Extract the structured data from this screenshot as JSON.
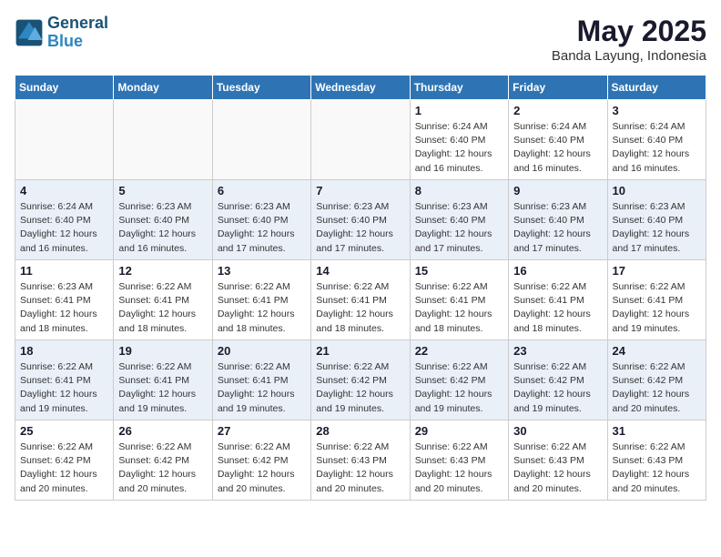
{
  "logo": {
    "line1": "General",
    "line2": "Blue"
  },
  "title": "May 2025",
  "location": "Banda Layung, Indonesia",
  "days_of_week": [
    "Sunday",
    "Monday",
    "Tuesday",
    "Wednesday",
    "Thursday",
    "Friday",
    "Saturday"
  ],
  "weeks": [
    [
      {
        "day": "",
        "info": ""
      },
      {
        "day": "",
        "info": ""
      },
      {
        "day": "",
        "info": ""
      },
      {
        "day": "",
        "info": ""
      },
      {
        "day": "1",
        "info": "Sunrise: 6:24 AM\nSunset: 6:40 PM\nDaylight: 12 hours\nand 16 minutes."
      },
      {
        "day": "2",
        "info": "Sunrise: 6:24 AM\nSunset: 6:40 PM\nDaylight: 12 hours\nand 16 minutes."
      },
      {
        "day": "3",
        "info": "Sunrise: 6:24 AM\nSunset: 6:40 PM\nDaylight: 12 hours\nand 16 minutes."
      }
    ],
    [
      {
        "day": "4",
        "info": "Sunrise: 6:24 AM\nSunset: 6:40 PM\nDaylight: 12 hours\nand 16 minutes."
      },
      {
        "day": "5",
        "info": "Sunrise: 6:23 AM\nSunset: 6:40 PM\nDaylight: 12 hours\nand 16 minutes."
      },
      {
        "day": "6",
        "info": "Sunrise: 6:23 AM\nSunset: 6:40 PM\nDaylight: 12 hours\nand 17 minutes."
      },
      {
        "day": "7",
        "info": "Sunrise: 6:23 AM\nSunset: 6:40 PM\nDaylight: 12 hours\nand 17 minutes."
      },
      {
        "day": "8",
        "info": "Sunrise: 6:23 AM\nSunset: 6:40 PM\nDaylight: 12 hours\nand 17 minutes."
      },
      {
        "day": "9",
        "info": "Sunrise: 6:23 AM\nSunset: 6:40 PM\nDaylight: 12 hours\nand 17 minutes."
      },
      {
        "day": "10",
        "info": "Sunrise: 6:23 AM\nSunset: 6:40 PM\nDaylight: 12 hours\nand 17 minutes."
      }
    ],
    [
      {
        "day": "11",
        "info": "Sunrise: 6:23 AM\nSunset: 6:41 PM\nDaylight: 12 hours\nand 18 minutes."
      },
      {
        "day": "12",
        "info": "Sunrise: 6:22 AM\nSunset: 6:41 PM\nDaylight: 12 hours\nand 18 minutes."
      },
      {
        "day": "13",
        "info": "Sunrise: 6:22 AM\nSunset: 6:41 PM\nDaylight: 12 hours\nand 18 minutes."
      },
      {
        "day": "14",
        "info": "Sunrise: 6:22 AM\nSunset: 6:41 PM\nDaylight: 12 hours\nand 18 minutes."
      },
      {
        "day": "15",
        "info": "Sunrise: 6:22 AM\nSunset: 6:41 PM\nDaylight: 12 hours\nand 18 minutes."
      },
      {
        "day": "16",
        "info": "Sunrise: 6:22 AM\nSunset: 6:41 PM\nDaylight: 12 hours\nand 18 minutes."
      },
      {
        "day": "17",
        "info": "Sunrise: 6:22 AM\nSunset: 6:41 PM\nDaylight: 12 hours\nand 19 minutes."
      }
    ],
    [
      {
        "day": "18",
        "info": "Sunrise: 6:22 AM\nSunset: 6:41 PM\nDaylight: 12 hours\nand 19 minutes."
      },
      {
        "day": "19",
        "info": "Sunrise: 6:22 AM\nSunset: 6:41 PM\nDaylight: 12 hours\nand 19 minutes."
      },
      {
        "day": "20",
        "info": "Sunrise: 6:22 AM\nSunset: 6:41 PM\nDaylight: 12 hours\nand 19 minutes."
      },
      {
        "day": "21",
        "info": "Sunrise: 6:22 AM\nSunset: 6:42 PM\nDaylight: 12 hours\nand 19 minutes."
      },
      {
        "day": "22",
        "info": "Sunrise: 6:22 AM\nSunset: 6:42 PM\nDaylight: 12 hours\nand 19 minutes."
      },
      {
        "day": "23",
        "info": "Sunrise: 6:22 AM\nSunset: 6:42 PM\nDaylight: 12 hours\nand 19 minutes."
      },
      {
        "day": "24",
        "info": "Sunrise: 6:22 AM\nSunset: 6:42 PM\nDaylight: 12 hours\nand 20 minutes."
      }
    ],
    [
      {
        "day": "25",
        "info": "Sunrise: 6:22 AM\nSunset: 6:42 PM\nDaylight: 12 hours\nand 20 minutes."
      },
      {
        "day": "26",
        "info": "Sunrise: 6:22 AM\nSunset: 6:42 PM\nDaylight: 12 hours\nand 20 minutes."
      },
      {
        "day": "27",
        "info": "Sunrise: 6:22 AM\nSunset: 6:42 PM\nDaylight: 12 hours\nand 20 minutes."
      },
      {
        "day": "28",
        "info": "Sunrise: 6:22 AM\nSunset: 6:43 PM\nDaylight: 12 hours\nand 20 minutes."
      },
      {
        "day": "29",
        "info": "Sunrise: 6:22 AM\nSunset: 6:43 PM\nDaylight: 12 hours\nand 20 minutes."
      },
      {
        "day": "30",
        "info": "Sunrise: 6:22 AM\nSunset: 6:43 PM\nDaylight: 12 hours\nand 20 minutes."
      },
      {
        "day": "31",
        "info": "Sunrise: 6:22 AM\nSunset: 6:43 PM\nDaylight: 12 hours\nand 20 minutes."
      }
    ]
  ]
}
